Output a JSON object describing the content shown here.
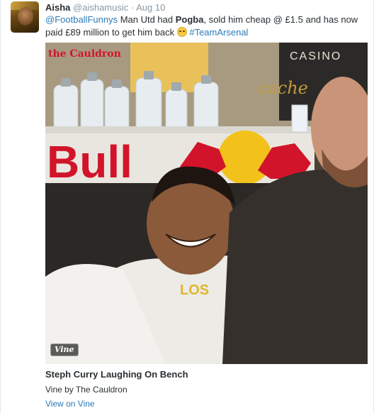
{
  "tweet": {
    "display_name": "Aisha",
    "handle": "@aishamusic",
    "separator": "·",
    "time": "Aug 10",
    "text_mention": "@FootballFunnys",
    "text_part1": " Man Utd had ",
    "text_bold": "Pogba",
    "text_part2": ", sold him cheap @ £1.5 and has now paid £89 million to get him back ",
    "emoji_icon": "face-with-tears-of-joy-icon",
    "hashtag": "#TeamArsenal"
  },
  "card": {
    "badge": "Vine",
    "scene_texts": {
      "brand_logo": "the Cauldron",
      "sponsor_word": "Bull",
      "casino_sign": "CASINO",
      "cache_sign": "cache"
    },
    "title": "Steph Curry Laughing On Bench",
    "subtitle": "Vine by The Cauldron",
    "link": "View on Vine"
  },
  "colors": {
    "link": "#2b7bb9",
    "muted": "#8899a6",
    "text": "#292f33",
    "redbull": "#d2142a"
  }
}
